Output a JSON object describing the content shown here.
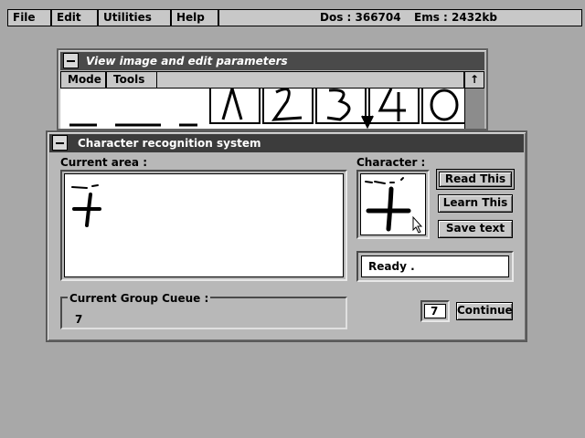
{
  "menu": {
    "file": "File",
    "edit": "Edit",
    "utilities": "Utilities",
    "help": "Help"
  },
  "status": {
    "dos": "Dos : 366704",
    "ems": "Ems : 2432kb"
  },
  "view_window": {
    "title": "View image and edit parameters",
    "mode_menu": "Mode",
    "tools_menu": "Tools",
    "scroll_up": "↑"
  },
  "dialog": {
    "title": "Character recognition system",
    "current_area_label": "Current area :",
    "character_label": "Character :",
    "read_this": "Read This",
    "learn_this": "Learn This",
    "save_text": "Save text",
    "status_value": "Ready .",
    "group_cueue_label": "Current Group Cueue :",
    "group_cueue_value": "7",
    "input_value": "7",
    "continue": "Continue"
  }
}
